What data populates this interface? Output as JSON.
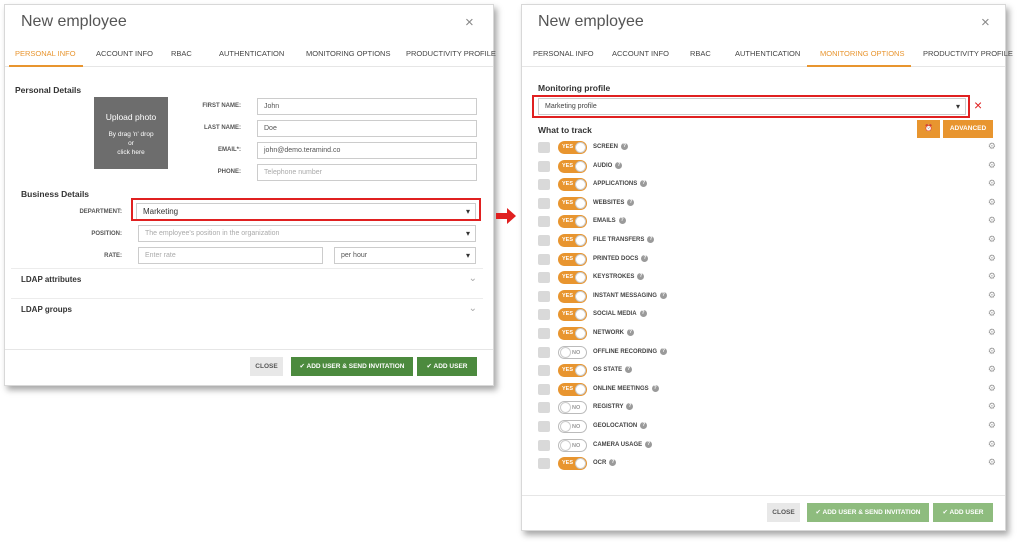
{
  "left_dialog": {
    "title": "New employee",
    "close_glyph": "×",
    "tabs": [
      "PERSONAL INFO",
      "ACCOUNT INFO",
      "RBAC",
      "AUTHENTICATION",
      "MONITORING OPTIONS",
      "PRODUCTIVITY PROFILE"
    ],
    "active_tab": "PERSONAL INFO",
    "personal_details_header": "Personal Details",
    "upload": {
      "title": "Upload photo",
      "line1": "By drag 'n' drop",
      "line2": "or",
      "line3": "click here"
    },
    "fields": {
      "first_name": {
        "label": "FIRST NAME:",
        "value": "John"
      },
      "last_name": {
        "label": "LAST NAME:",
        "value": "Doe"
      },
      "email": {
        "label": "EMAIL*:",
        "value": "john@demo.teramind.co"
      },
      "phone": {
        "label": "PHONE:",
        "placeholder": "Telephone number"
      }
    },
    "business_details_header": "Business Details",
    "department": {
      "label": "DEPARTMENT:",
      "value": "Marketing"
    },
    "position": {
      "label": "POSITION:",
      "placeholder": "The employee's position in the organization"
    },
    "rate": {
      "label": "RATE:",
      "placeholder": "Enter rate",
      "unit": "per hour"
    },
    "sections": [
      "LDAP attributes",
      "LDAP groups"
    ],
    "footer": {
      "close": "CLOSE",
      "add_send": "ADD USER & SEND INVITATION",
      "add": "ADD USER"
    }
  },
  "right_dialog": {
    "title": "New employee",
    "close_glyph": "×",
    "tabs": [
      "PERSONAL INFO",
      "ACCOUNT INFO",
      "RBAC",
      "AUTHENTICATION",
      "MONITORING OPTIONS",
      "PRODUCTIVITY PROFILE"
    ],
    "active_tab": "MONITORING OPTIONS",
    "monitoring_profile_header": "Monitoring profile",
    "monitoring_profile_value": "Marketing profile",
    "clear_glyph": "×",
    "what_to_track_header": "What to track",
    "advanced_label": "ADVANCED",
    "track_items": [
      {
        "label": "SCREEN",
        "state": "YES",
        "icon": "video-camera-icon"
      },
      {
        "label": "AUDIO",
        "state": "YES",
        "icon": "speaker-icon"
      },
      {
        "label": "APPLICATIONS",
        "state": "YES",
        "icon": "app-window-icon"
      },
      {
        "label": "WEBSITES",
        "state": "YES",
        "icon": "browser-icon"
      },
      {
        "label": "EMAILS",
        "state": "YES",
        "icon": "envelope-icon"
      },
      {
        "label": "FILE TRANSFERS",
        "state": "YES",
        "icon": "file-transfer-icon"
      },
      {
        "label": "PRINTED DOCS",
        "state": "YES",
        "icon": "printer-icon"
      },
      {
        "label": "KEYSTROKES",
        "state": "YES",
        "icon": "keyboard-icon"
      },
      {
        "label": "INSTANT MESSAGING",
        "state": "YES",
        "icon": "chat-icon"
      },
      {
        "label": "SOCIAL MEDIA",
        "state": "YES",
        "icon": "people-icon"
      },
      {
        "label": "NETWORK",
        "state": "YES",
        "icon": "cloud-icon"
      },
      {
        "label": "OFFLINE RECORDING",
        "state": "NO",
        "icon": "pause-icon"
      },
      {
        "label": "OS STATE",
        "state": "YES",
        "icon": "monitor-icon"
      },
      {
        "label": "ONLINE MEETINGS",
        "state": "YES",
        "icon": "phone-icon"
      },
      {
        "label": "REGISTRY",
        "state": "NO",
        "icon": "registry-icon"
      },
      {
        "label": "GEOLOCATION",
        "state": "NO",
        "icon": "compass-icon"
      },
      {
        "label": "CAMERA USAGE",
        "state": "NO",
        "icon": "camera-icon"
      },
      {
        "label": "OCR",
        "state": "YES",
        "icon": "eye-icon"
      }
    ],
    "footer": {
      "close": "CLOSE",
      "add_send": "ADD USER & SEND INVITATION",
      "add": "ADD USER"
    }
  },
  "colors": {
    "accent": "#e8952f",
    "green": "#4c8a3e",
    "highlight_red": "#e02020"
  }
}
